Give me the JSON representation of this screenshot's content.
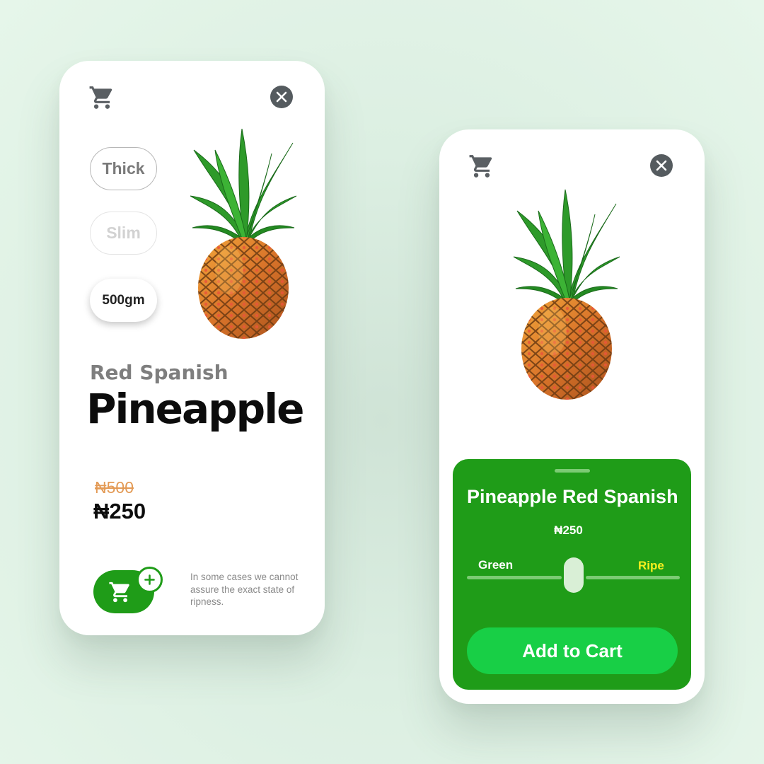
{
  "colors": {
    "brand_green": "#1f9c18",
    "button_green": "#18cf46",
    "ripe_yellow": "#f6ef1f",
    "old_price_orange": "#e39a55"
  },
  "icons": {
    "cart": "shopping-cart-icon",
    "close": "close-icon",
    "plus": "plus-icon"
  },
  "left_card": {
    "options": [
      "Thick",
      "Slim",
      "500gm"
    ],
    "selected_option": "500gm",
    "subtitle": "Red Spanish",
    "title": "Pineapple",
    "old_price": "₦500",
    "price": "₦250",
    "note": "In some cases we cannot assure the exact state of ripness."
  },
  "right_card": {
    "sheet_title": "Pineapple Red Spanish",
    "price": "₦250",
    "slider": {
      "min_label": "Green",
      "max_label": "Ripe",
      "value": 0.5
    },
    "cta_label": "Add to Cart"
  }
}
